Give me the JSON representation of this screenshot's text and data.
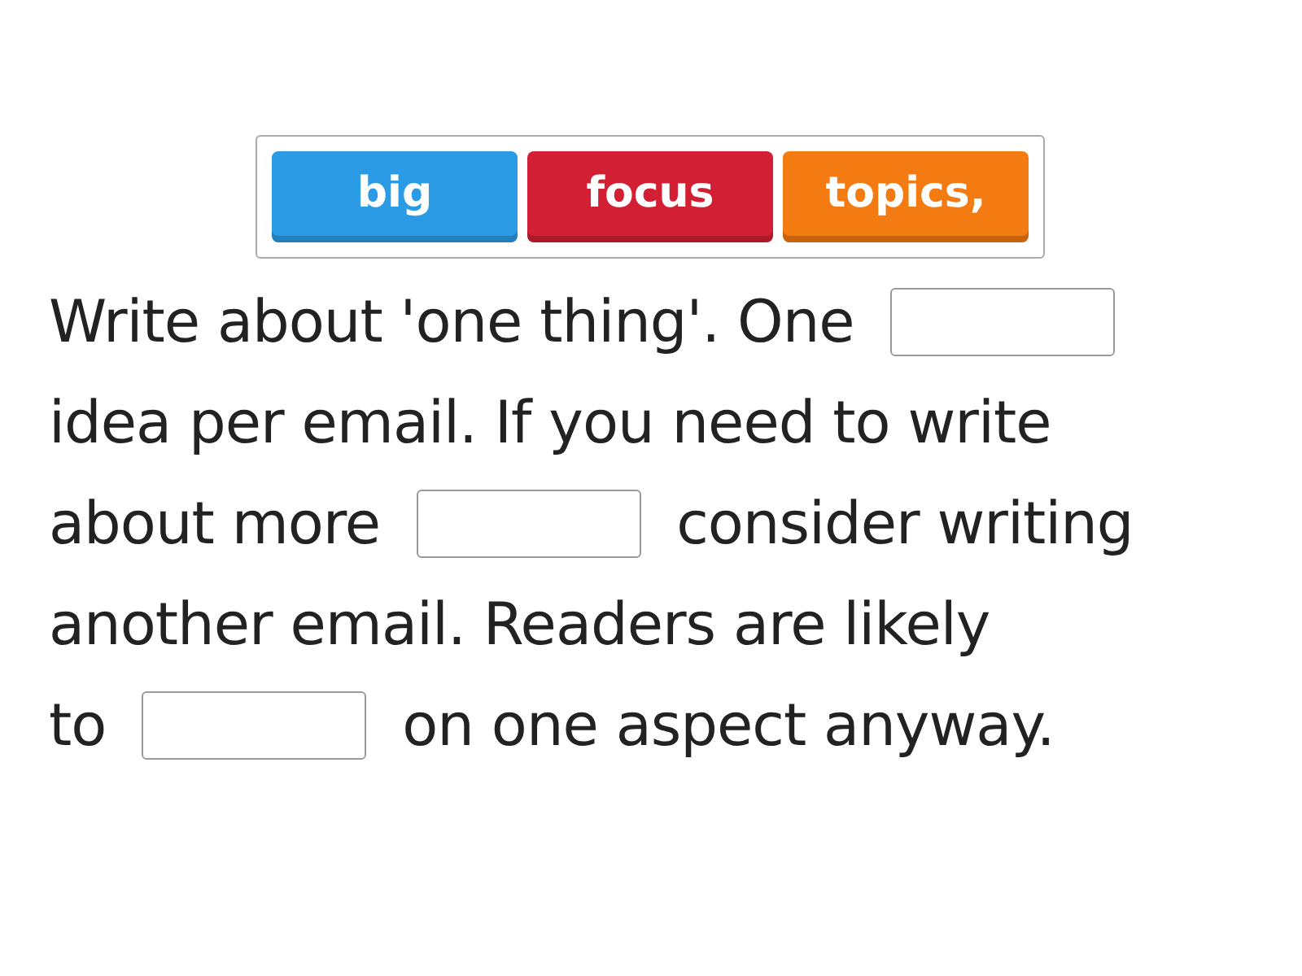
{
  "tiles": [
    {
      "text": "big",
      "color": "#2b9be6"
    },
    {
      "text": "focus",
      "color": "#d21f33"
    },
    {
      "text": "topics,",
      "color": "#f47a12"
    }
  ],
  "lines": [
    [
      {
        "kind": "text",
        "text": "Write about 'one thing'. One"
      },
      {
        "kind": "blank"
      }
    ],
    [
      {
        "kind": "text",
        "text": "idea per email. If you need to write"
      }
    ],
    [
      {
        "kind": "text",
        "text": "about more"
      },
      {
        "kind": "blank"
      },
      {
        "kind": "text",
        "text": "consider writing"
      }
    ],
    [
      {
        "kind": "text",
        "text": "another email. Readers are likely"
      }
    ],
    [
      {
        "kind": "text",
        "text": "to"
      },
      {
        "kind": "blank"
      },
      {
        "kind": "text",
        "text": "on one aspect anyway."
      }
    ]
  ]
}
